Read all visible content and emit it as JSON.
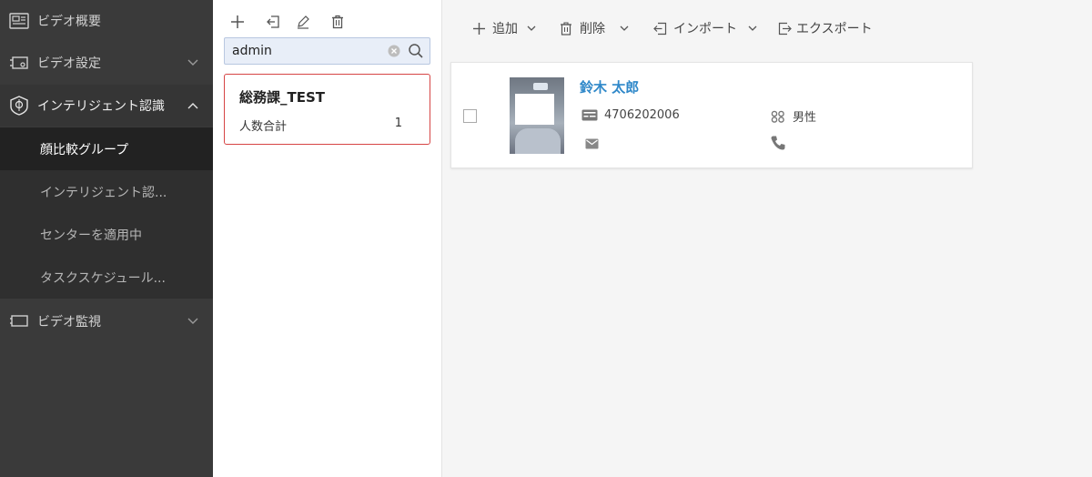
{
  "sidebar": {
    "items": [
      {
        "label": "ビデオ概要",
        "icon": "overview-icon"
      },
      {
        "label": "ビデオ設定",
        "icon": "camera-settings-icon"
      },
      {
        "label": "インテリジェント認識",
        "icon": "intelligent-recognition-icon"
      },
      {
        "label": "ビデオ監視",
        "icon": "monitor-icon"
      }
    ],
    "subitems": [
      {
        "label": "顔比較グループ"
      },
      {
        "label": "インテリジェント認..."
      },
      {
        "label": "センターを適用中"
      },
      {
        "label": "タスクスケジュール..."
      }
    ]
  },
  "group_panel": {
    "tools": [
      "add-icon",
      "import-icon",
      "edit-icon",
      "delete-icon"
    ],
    "search": {
      "value": "admin"
    },
    "groups": [
      {
        "name": "総務課_TEST",
        "count_label": "人数合計",
        "count": "1"
      }
    ]
  },
  "toolbar": {
    "add_label": "追加",
    "delete_label": "削除",
    "import_label": "インポート",
    "export_label": "エクスポート"
  },
  "persons": [
    {
      "name": "鈴木 太郎",
      "id_number": "4706202006",
      "gender": "男性",
      "email": "",
      "phone": ""
    }
  ],
  "colors": {
    "sidebar_bg": "#3a3a3a",
    "active_item_bg": "#222222",
    "selected_border": "#d64545",
    "name_link": "#2f88c9",
    "search_bg": "#e8eef8"
  }
}
